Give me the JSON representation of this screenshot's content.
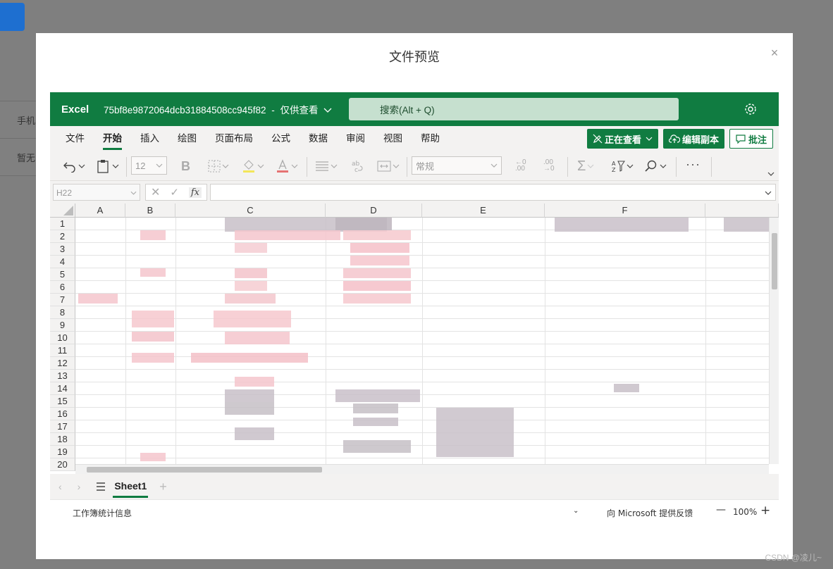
{
  "background": {
    "row1_text": "手机",
    "row2_text": "暂无"
  },
  "modal": {
    "title": "文件预览",
    "close_glyph": "×"
  },
  "excel": {
    "app_name": "Excel",
    "file_name": "75bf8e9872064dcb31884508cc945f82",
    "separator": "-",
    "view_mode": "仅供查看",
    "search_placeholder": "搜索(Alt + Q)",
    "tabs": [
      "文件",
      "开始",
      "插入",
      "绘图",
      "页面布局",
      "公式",
      "数据",
      "审阅",
      "视图",
      "帮助"
    ],
    "active_tab": "开始",
    "buttons": {
      "viewing": "正在查看",
      "edit_copy": "编辑副本",
      "comment": "批注"
    },
    "toolbar": {
      "font_size": "12",
      "number_format": "常规"
    },
    "formula": {
      "name_box": "H22",
      "fx": "fx"
    },
    "columns": [
      "A",
      "B",
      "C",
      "D",
      "E",
      "F"
    ],
    "rows": [
      "1",
      "2",
      "3",
      "4",
      "5",
      "6",
      "7",
      "8",
      "9",
      "10",
      "11",
      "12",
      "13",
      "14",
      "15",
      "16",
      "17",
      "18",
      "19",
      "20"
    ],
    "sheet": {
      "name": "Sheet1",
      "add": "+"
    },
    "status": {
      "workbook_stats": "工作簿统计信息",
      "feedback": "向 Microsoft 提供反馈",
      "zoom": "100%",
      "zoom_minus": "—",
      "zoom_plus": "+"
    },
    "accent_color": "#107c41"
  },
  "watermark": "CSDN @凌儿~"
}
